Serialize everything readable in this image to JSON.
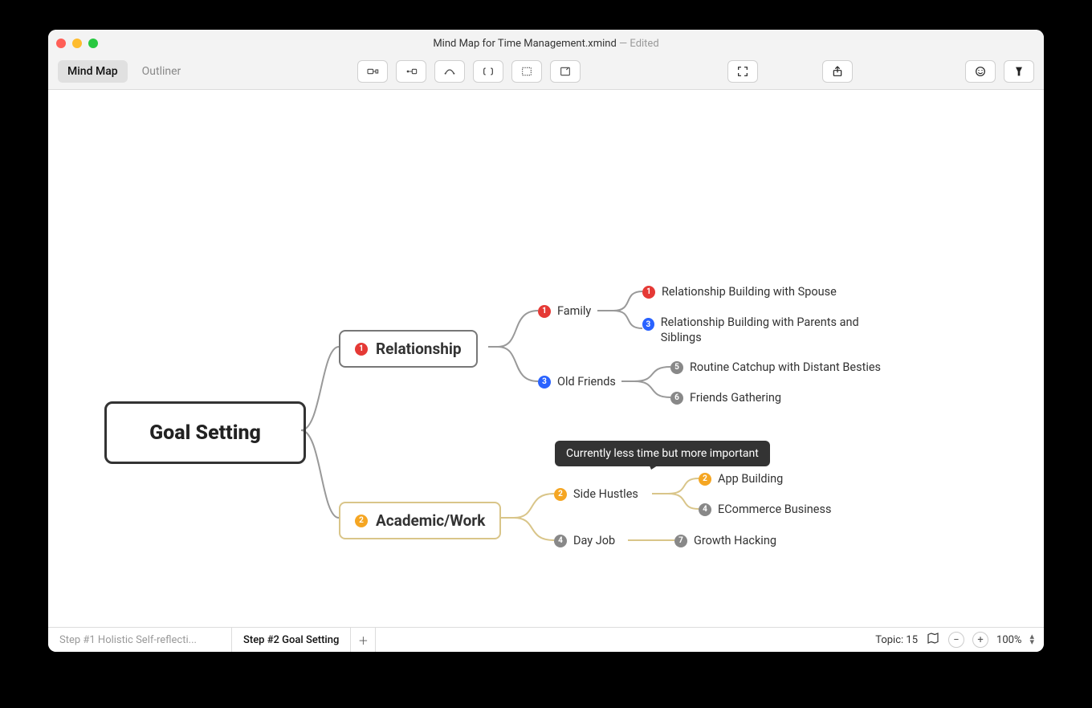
{
  "window": {
    "title": "Mind Map for Time Management.xmind",
    "status": "Edited"
  },
  "toolbar": {
    "view_mindmap": "Mind Map",
    "view_outliner": "Outliner"
  },
  "mindmap": {
    "root": "Goal Setting",
    "branch1": {
      "priority": "1",
      "label": "Relationship"
    },
    "branch2": {
      "priority": "2",
      "label": "Academic/Work"
    },
    "n_family": {
      "priority": "1",
      "label": "Family"
    },
    "n_oldfriends": {
      "priority": "3",
      "label": "Old Friends"
    },
    "n_sidehustles": {
      "priority": "2",
      "label": "Side Hustles"
    },
    "n_dayjob": {
      "priority": "4",
      "label": "Day Job"
    },
    "leaf_spouse": {
      "priority": "1",
      "label": "Relationship Building with Spouse"
    },
    "leaf_parents": {
      "priority": "3",
      "label": "Relationship Building with Parents and Siblings"
    },
    "leaf_besties": {
      "priority": "5",
      "label": "Routine Catchup with Distant Besties"
    },
    "leaf_gather": {
      "priority": "6",
      "label": "Friends Gathering"
    },
    "leaf_app": {
      "priority": "2",
      "label": "App Building"
    },
    "leaf_ecom": {
      "priority": "4",
      "label": "ECommerce Business"
    },
    "leaf_growth": {
      "priority": "7",
      "label": "Growth Hacking"
    },
    "callout": "Currently less time but more important"
  },
  "footer": {
    "sheet1": "Step #1 Holistic Self-reflecti...",
    "sheet2": "Step #2 Goal Setting",
    "topic_label": "Topic: 15",
    "zoom": "100%"
  }
}
